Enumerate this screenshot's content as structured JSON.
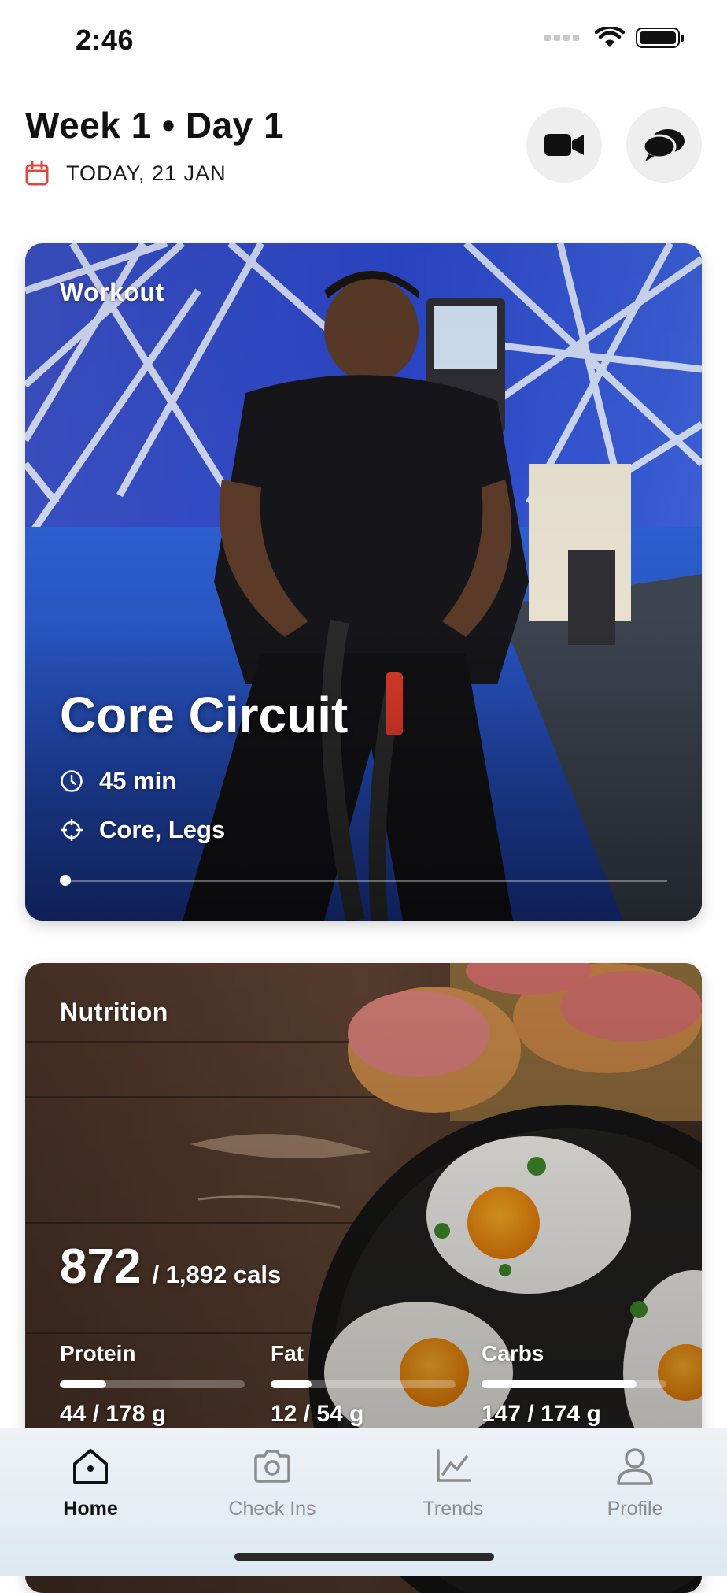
{
  "status_bar": {
    "time": "2:46"
  },
  "header": {
    "title": "Week 1 • Day 1",
    "date": "TODAY, 21 JAN",
    "video_icon": "video-camera-icon",
    "chat_icon": "chat-bubbles-icon"
  },
  "workout": {
    "label": "Workout",
    "title": "Core Circuit",
    "duration": "45 min",
    "focus": "Core, Legs",
    "progress": 0
  },
  "nutrition": {
    "label": "Nutrition",
    "calories_consumed": "872",
    "calories_target": "/ 1,892 cals",
    "macros": [
      {
        "name": "Protein",
        "value": "44 / 178 g",
        "fraction": 0.25
      },
      {
        "name": "Fat",
        "value": "12 / 54 g",
        "fraction": 0.22
      },
      {
        "name": "Carbs",
        "value": "147 / 174 g",
        "fraction": 0.84
      }
    ]
  },
  "tabs": [
    {
      "label": "Home",
      "icon": "home-icon",
      "active": true
    },
    {
      "label": "Check Ins",
      "icon": "camera-icon",
      "active": false
    },
    {
      "label": "Trends",
      "icon": "chart-icon",
      "active": false
    },
    {
      "label": "Profile",
      "icon": "person-icon",
      "active": false
    }
  ],
  "colors": {
    "accent_red": "#e0483e",
    "tab_active": "#111111",
    "tab_inactive": "#8c8c8c"
  }
}
